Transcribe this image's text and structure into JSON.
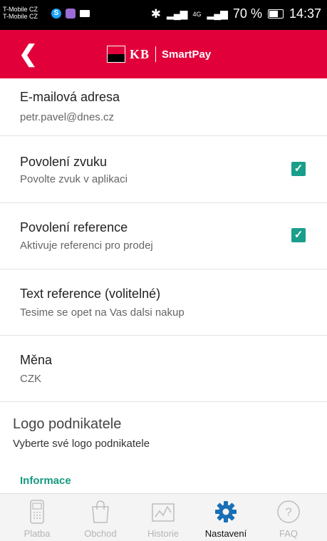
{
  "status_bar": {
    "carriers": [
      "T-Mobile CZ",
      "T-Mobile CZ"
    ],
    "network": "4G",
    "battery": "70 %",
    "time": "14:37"
  },
  "header": {
    "brand_kb": "KB",
    "brand_app": "SmartPay"
  },
  "settings": {
    "email": {
      "title": "E-mailová adresa",
      "value": "petr.pavel@dnes.cz"
    },
    "sound": {
      "title": "Povolení zvuku",
      "sub": "Povolte zvuk v aplikaci",
      "checked": true
    },
    "reference": {
      "title": "Povolení reference",
      "sub": "Aktivuje referenci pro prodej",
      "checked": true
    },
    "ref_text": {
      "title": "Text reference (volitelné)",
      "value": "Tesime se opet na Vas dalsi nakup"
    },
    "currency": {
      "title": "Měna",
      "value": "CZK"
    },
    "logo": {
      "title": "Logo podnikatele",
      "sub": "Vyberte své logo podnikatele"
    },
    "info_heading": "Informace"
  },
  "bottom_nav": [
    {
      "label": "Platba",
      "icon": "terminal-icon",
      "active": false
    },
    {
      "label": "Obchod",
      "icon": "shopping-bag-icon",
      "active": false
    },
    {
      "label": "Historie",
      "icon": "chart-icon",
      "active": false
    },
    {
      "label": "Nastavení",
      "icon": "gear-icon",
      "active": true
    },
    {
      "label": "FAQ",
      "icon": "question-icon",
      "active": false
    }
  ],
  "colors": {
    "accent": "#e2003b",
    "checkbox": "#1a9e8c",
    "info": "#17987f"
  }
}
